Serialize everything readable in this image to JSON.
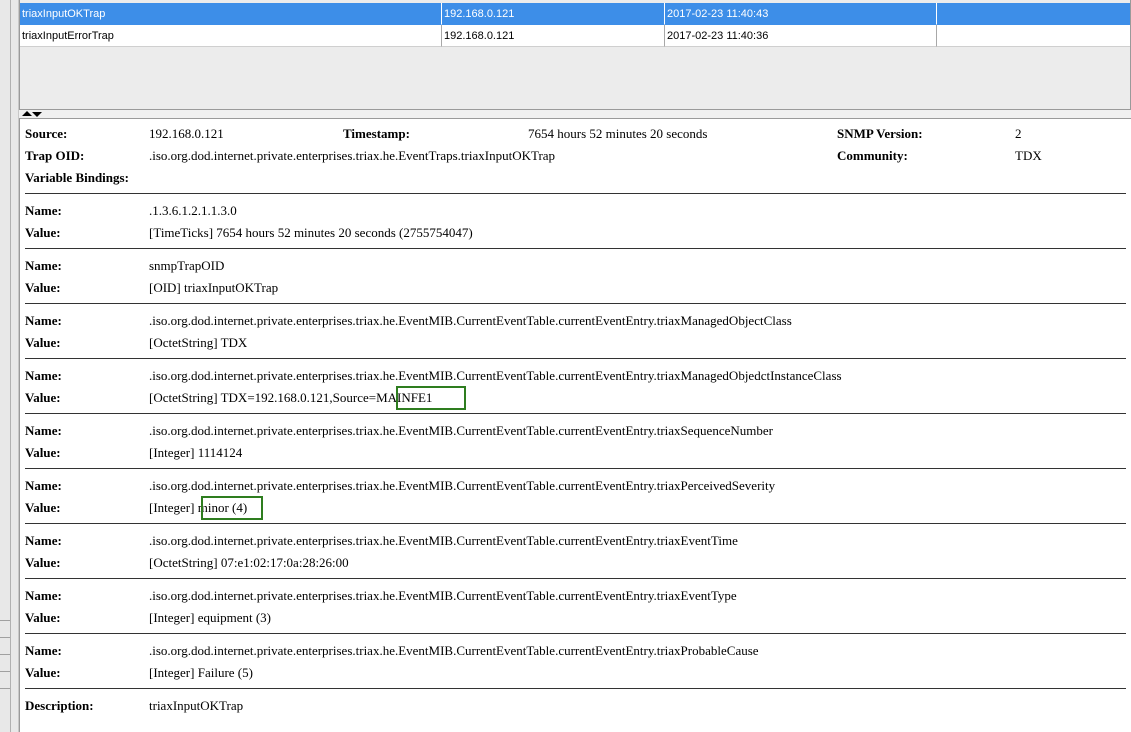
{
  "traps": [
    {
      "name": "triaxInputOKTrap",
      "source": "192.168.0.121",
      "time": "2017-02-23 11:40:43",
      "extra": "",
      "selected": true
    },
    {
      "name": "triaxInputErrorTrap",
      "source": "192.168.0.121",
      "time": "2017-02-23 11:40:36",
      "extra": "",
      "selected": false
    }
  ],
  "details": {
    "source_label": "Source:",
    "source_value": "192.168.0.121",
    "timestamp_label": "Timestamp:",
    "timestamp_value": "7654 hours 52 minutes 20 seconds",
    "snmp_version_label": "SNMP Version:",
    "snmp_version_value": "2",
    "trap_oid_label": "Trap OID:",
    "trap_oid_value": ".iso.org.dod.internet.private.enterprises.triax.he.EventTraps.triaxInputOKTrap",
    "community_label": "Community:",
    "community_value": "TDX",
    "varbind_label": "Variable Bindings:"
  },
  "bindings": {
    "name_label": "Name:",
    "value_label": "Value:",
    "items": [
      {
        "name": ".1.3.6.1.2.1.1.3.0",
        "value": "[TimeTicks] 7654 hours 52 minutes 20 seconds (2755754047)"
      },
      {
        "name": "snmpTrapOID",
        "value": "[OID] triaxInputOKTrap"
      },
      {
        "name": ".iso.org.dod.internet.private.enterprises.triax.he.EventMIB.CurrentEventTable.currentEventEntry.triaxManagedObjectClass",
        "value": "[OctetString] TDX"
      },
      {
        "name": ".iso.org.dod.internet.private.enterprises.triax.he.EventMIB.CurrentEventTable.currentEventEntry.triaxManagedObjedctInstanceClass",
        "value": "[OctetString] TDX=192.168.0.121,Source=MAINFE1"
      },
      {
        "name": ".iso.org.dod.internet.private.enterprises.triax.he.EventMIB.CurrentEventTable.currentEventEntry.triaxSequenceNumber",
        "value": "[Integer] 1114124"
      },
      {
        "name": ".iso.org.dod.internet.private.enterprises.triax.he.EventMIB.CurrentEventTable.currentEventEntry.triaxPerceivedSeverity",
        "value": "[Integer] minor (4)"
      },
      {
        "name": ".iso.org.dod.internet.private.enterprises.triax.he.EventMIB.CurrentEventTable.currentEventEntry.triaxEventTime",
        "value": "[OctetString] 07:e1:02:17:0a:28:26:00"
      },
      {
        "name": ".iso.org.dod.internet.private.enterprises.triax.he.EventMIB.CurrentEventTable.currentEventEntry.triaxEventType",
        "value": "[Integer] equipment (3)"
      },
      {
        "name": ".iso.org.dod.internet.private.enterprises.triax.he.EventMIB.CurrentEventTable.currentEventEntry.triaxProbableCause",
        "value": "[Integer] Failure (5)"
      }
    ]
  },
  "description": {
    "label": "Description:",
    "value": "triaxInputOKTrap"
  },
  "colors": {
    "selection": "#3d8ee8",
    "highlight_border": "#2e7d1f"
  }
}
